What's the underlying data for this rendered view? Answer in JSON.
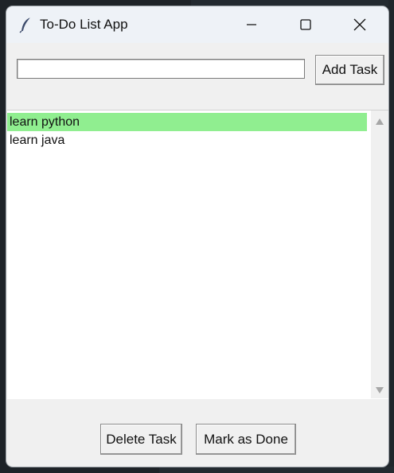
{
  "window": {
    "title": "To-Do List App",
    "icon": "feather-icon",
    "controls": {
      "minimize": "minimize-icon",
      "maximize": "maximize-icon",
      "close": "close-icon"
    }
  },
  "entry": {
    "value": "",
    "placeholder": ""
  },
  "buttons": {
    "add_task": "Add Task",
    "delete_task": "Delete Task",
    "mark_done": "Mark as Done"
  },
  "tasks": [
    {
      "label": "learn python",
      "done": true
    },
    {
      "label": "learn java",
      "done": false
    }
  ],
  "colors": {
    "done_highlight": "#90ee90",
    "window_bg": "#f0f0f0",
    "titlebar_bg": "#eef2f7"
  }
}
